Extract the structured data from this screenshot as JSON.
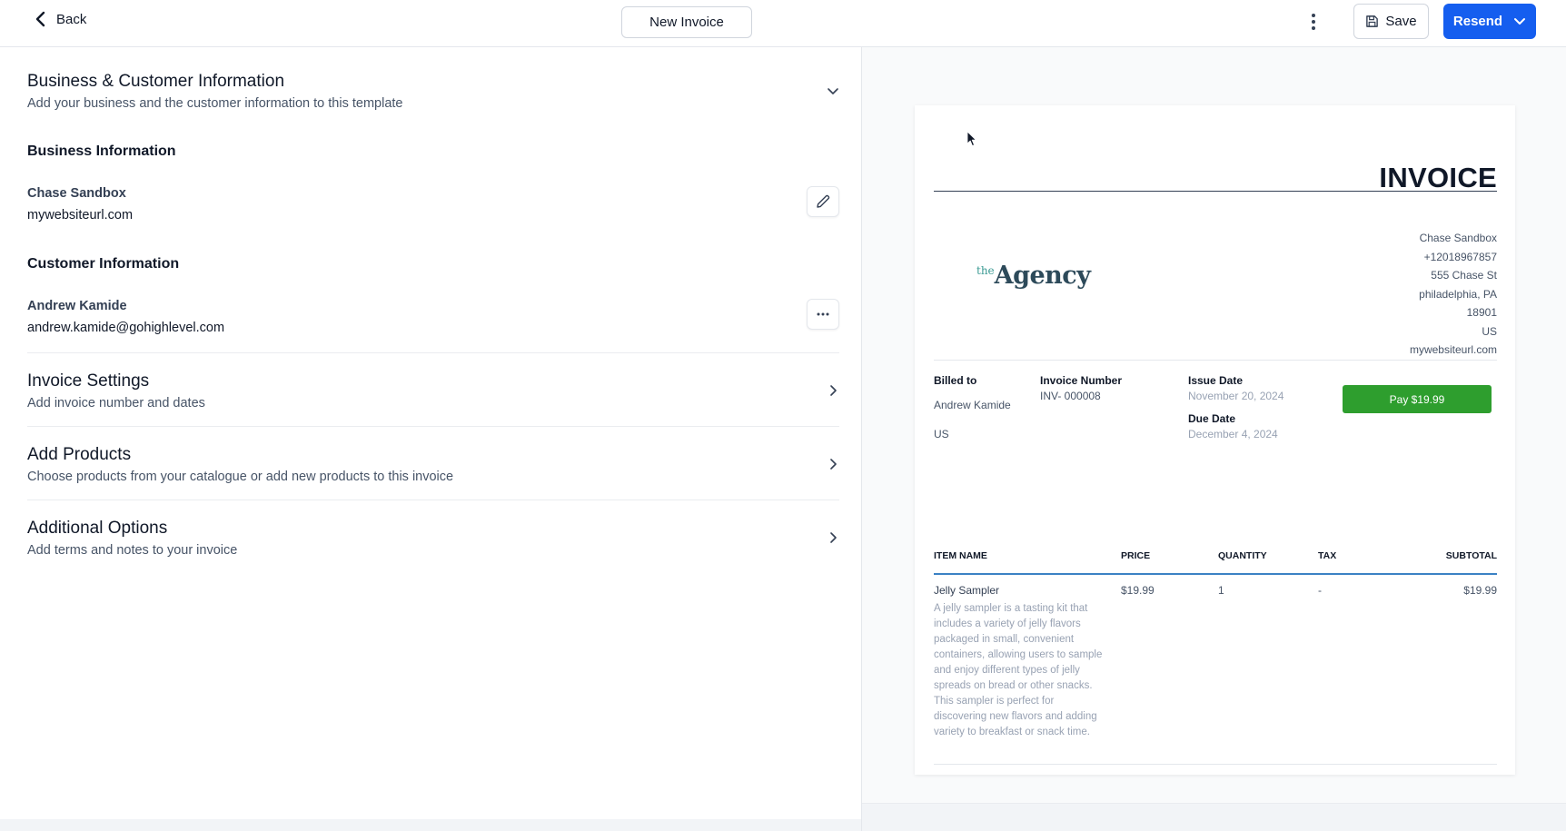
{
  "header": {
    "back_label": "Back",
    "document_title": "New Invoice",
    "save_label": "Save",
    "resend_label": "Resend"
  },
  "sections": {
    "business_customer": {
      "title": "Business & Customer Information",
      "subtitle": "Add your business and the customer information to this template"
    },
    "business_info": {
      "heading": "Business Information",
      "name": "Chase Sandbox",
      "website": "mywebsiteurl.com"
    },
    "customer_info": {
      "heading": "Customer Information",
      "name": "Andrew Kamide",
      "email": "andrew.kamide@gohighlevel.com"
    },
    "invoice_settings": {
      "title": "Invoice Settings",
      "subtitle": "Add invoice number and dates"
    },
    "add_products": {
      "title": "Add Products",
      "subtitle": "Choose products from your catalogue or add new products to this invoice"
    },
    "additional_options": {
      "title": "Additional Options",
      "subtitle": "Add terms and notes to your invoice"
    }
  },
  "preview": {
    "heading": "INVOICE",
    "logo_prefix": "the",
    "logo_name": "Agency",
    "business_lines": [
      "Chase Sandbox",
      "+12018967857",
      "555 Chase St",
      "philadelphia, PA",
      "18901",
      "US",
      "mywebsiteurl.com"
    ],
    "billed_to_label": "Billed to",
    "billed_to_name": "Andrew Kamide",
    "billed_to_country": "US",
    "invoice_number_label": "Invoice Number",
    "invoice_number": "INV- 000008",
    "issue_date_label": "Issue Date",
    "issue_date": "November 20, 2024",
    "due_date_label": "Due Date",
    "due_date": "December 4, 2024",
    "pay_button": "Pay $19.99",
    "table": {
      "columns": [
        "ITEM NAME",
        "PRICE",
        "QUANTITY",
        "TAX",
        "SUBTOTAL"
      ],
      "rows": [
        {
          "name": "Jelly Sampler",
          "description": "A jelly sampler is a tasting kit that includes a variety of jelly flavors packaged in small, convenient containers, allowing users to sample and enjoy different types of jelly spreads on bread or other snacks. This sampler is perfect for discovering new flavors and adding variety to breakfast or snack time.",
          "price": "$19.99",
          "quantity": "1",
          "tax": "-",
          "subtotal": "$19.99"
        }
      ]
    }
  },
  "colors": {
    "primary": "#155eef",
    "pay_green": "#2e9e2e",
    "table_rule": "#3b82c4"
  }
}
